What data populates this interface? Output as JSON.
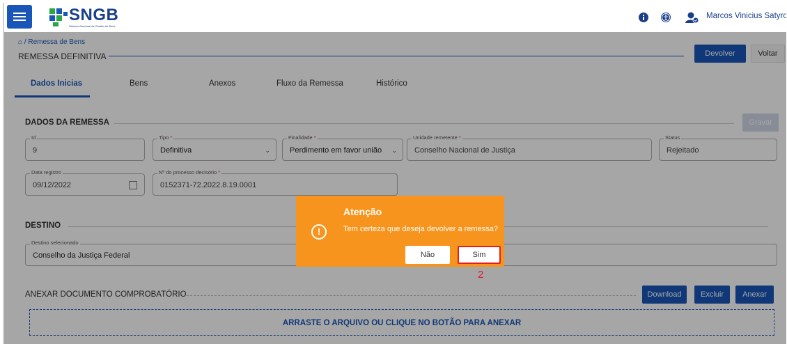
{
  "app": {
    "logo": "SNGB",
    "logo_subtitle": "Sistema Nacional de Gestão de Bens",
    "user_name": "Marcos Vinicius Satyro C..."
  },
  "breadcrumb": "/ Remessa de Bens",
  "page_title": "REMESSA DEFINITIVA",
  "header_buttons": {
    "devolver": "Devolver",
    "voltar": "Voltar"
  },
  "tabs": [
    "Dados Inicias",
    "Bens",
    "Anexos",
    "Fluxo da Remessa",
    "Histórico"
  ],
  "dados": {
    "section_title": "DADOS DA REMESSA",
    "gravar": "Gravar",
    "fields": {
      "id": {
        "label": "Id",
        "value": "9"
      },
      "tipo": {
        "label": "Tipo",
        "value": "Definitiva"
      },
      "finalidade": {
        "label": "Finalidade",
        "value": "Perdimento em favor união"
      },
      "unidade": {
        "label": "Unidade remetente",
        "value": "Conselho Nacional de Justiça"
      },
      "status": {
        "label": "Status",
        "value": "Rejeitado"
      },
      "data_registro": {
        "label": "Data registro",
        "value": "09/12/2022"
      },
      "processo": {
        "label": "Nº do processo decisório",
        "value": "0152371-72.2022.8.19.0001"
      }
    },
    "required_mark": "*"
  },
  "destino": {
    "section_title": "DESTINO",
    "label": "Destino selecionado",
    "value": "Conselho da Justiça Federal"
  },
  "anexar": {
    "section_title": "ANEXAR DOCUMENTO COMPROBATÓRIO",
    "buttons": {
      "download": "Download",
      "excluir": "Excluir",
      "anexar": "Anexar"
    },
    "dropzone_text": "ARRASTE O ARQUIVO OU CLIQUE NO BOTÃO PARA ANEXAR"
  },
  "dialog": {
    "title": "Atenção",
    "message": "Tem certeza que deseja devolver a remessa?",
    "icon_glyph": "!",
    "no": "Não",
    "yes": "Sim"
  },
  "annotation": "2",
  "colors": {
    "primary": "#1a56b8",
    "dialog": "#f7941d",
    "highlight": "#e02020"
  }
}
